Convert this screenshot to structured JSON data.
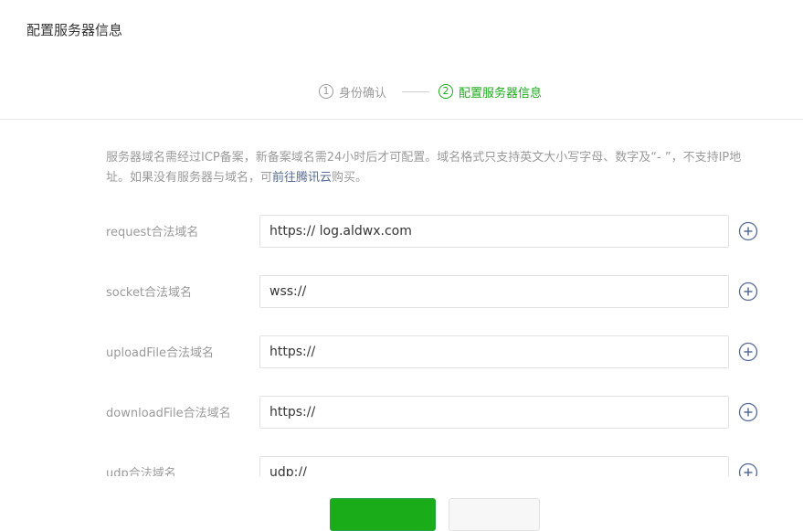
{
  "page": {
    "title": "配置服务器信息"
  },
  "steps": [
    {
      "num": "1",
      "label": "身份确认"
    },
    {
      "num": "2",
      "label": "配置服务器信息"
    }
  ],
  "notice": {
    "text_before": "服务器域名需经过ICP备案，新备案域名需24小时后才可配置。域名格式只支持英文大小写字母、数字及“- ”，不支持IP地址。如果没有服务器与域名，可",
    "link": "前往腾讯云",
    "text_after": "购买。"
  },
  "fields": [
    {
      "label": "request合法域名",
      "value": "https:// log.aldwx.com"
    },
    {
      "label": "socket合法域名",
      "value": "wss://"
    },
    {
      "label": "uploadFile合法域名",
      "value": "https://"
    },
    {
      "label": "downloadFile合法域名",
      "value": "https://"
    },
    {
      "label": "udp合法域名",
      "value": "udp://"
    }
  ],
  "colors": {
    "accent": "#1aad19",
    "link": "#576b95",
    "muted": "#9a9a9a",
    "icon": "#576b95"
  },
  "icons": {
    "add": "plus-circle-icon"
  }
}
